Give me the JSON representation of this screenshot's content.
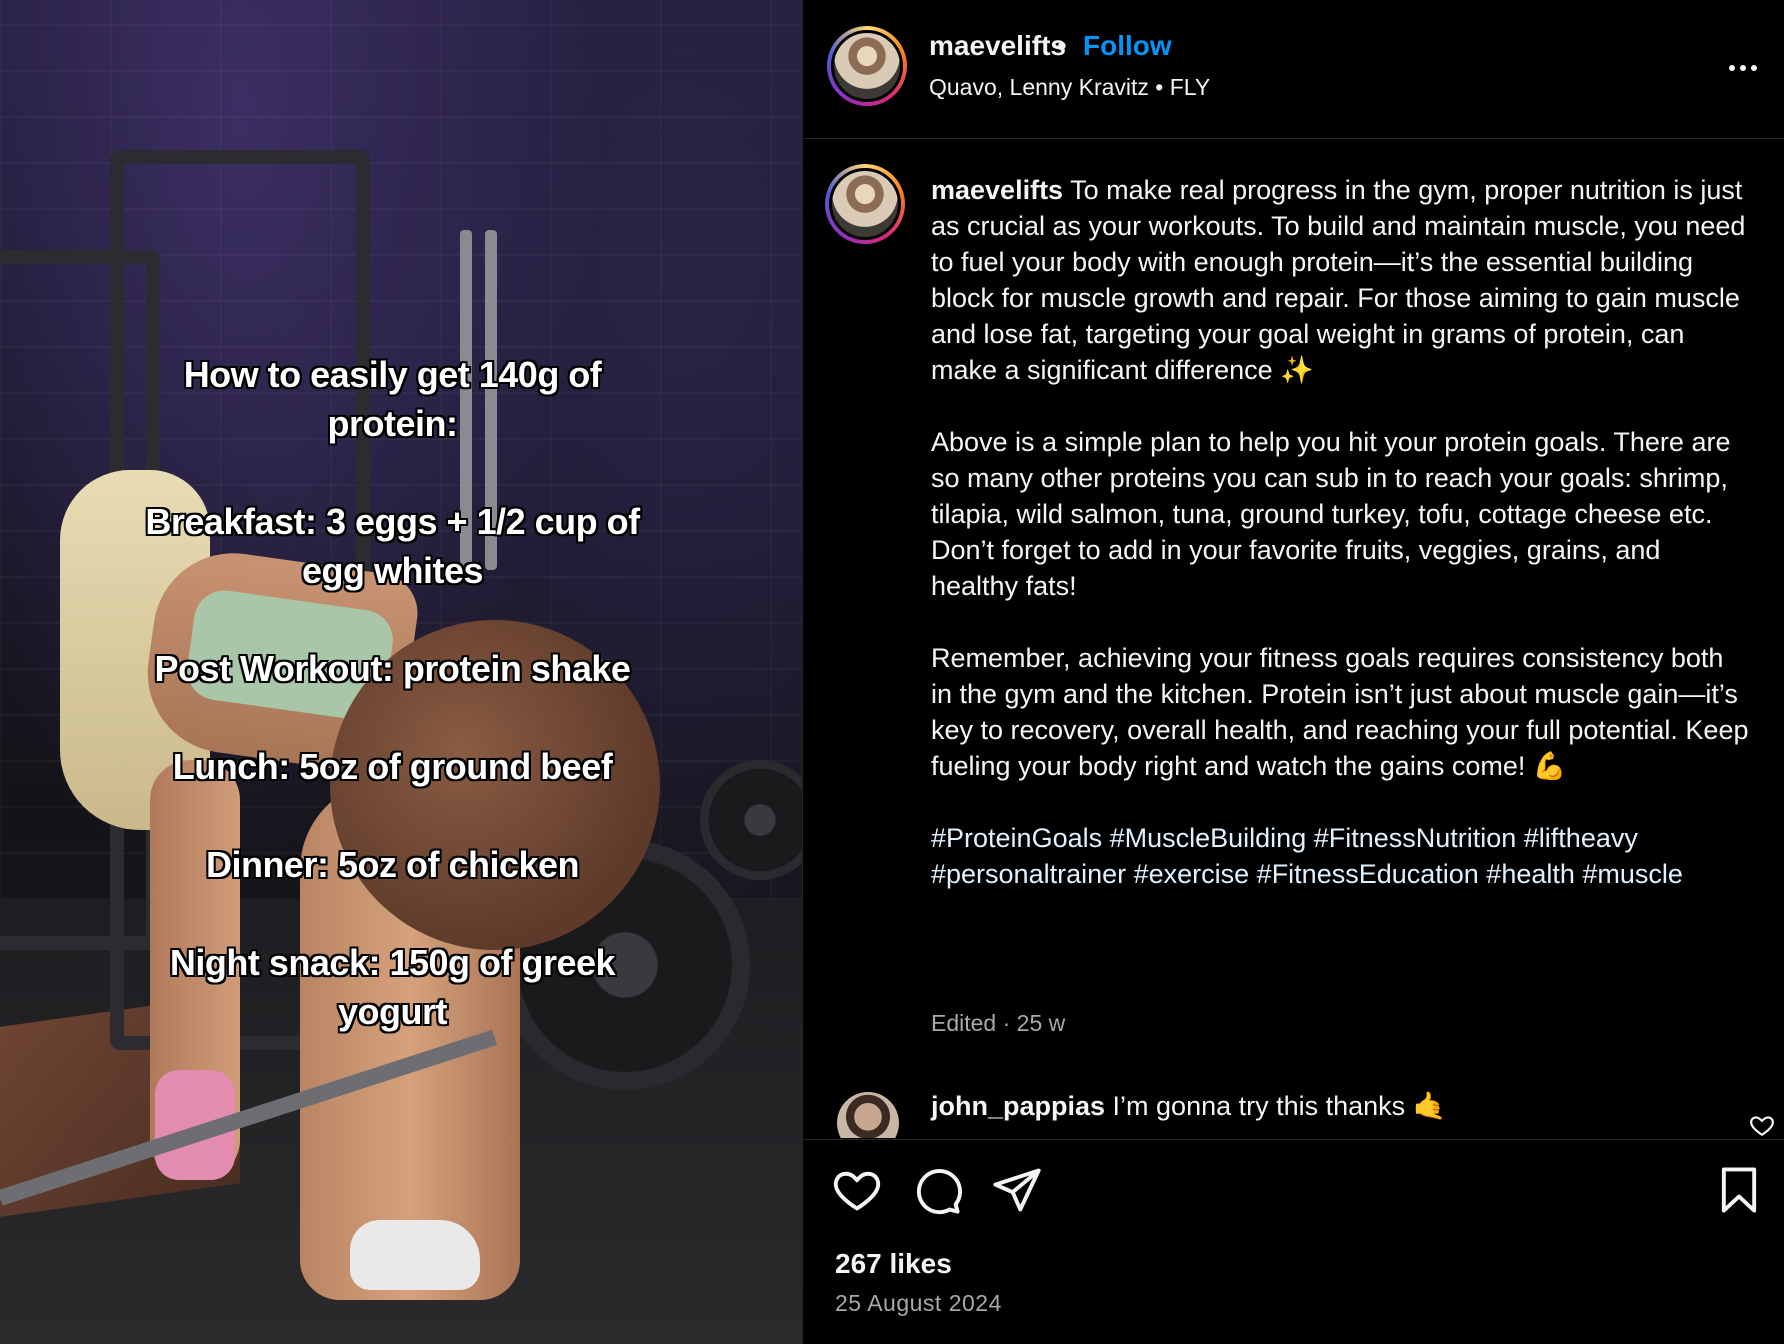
{
  "media": {
    "overlay_lines": [
      "How to easily get 140g of protein:",
      "Breakfast: 3 eggs + 1/2 cup of egg whites",
      "Post Workout: protein shake",
      "Lunch: 5oz of ground beef",
      "Dinner: 5oz of chicken",
      "Night snack: 150g of greek yogurt"
    ]
  },
  "header": {
    "username": "maevelifts",
    "separator": "•",
    "follow_label": "Follow",
    "audio": "Quavo, Lenny Kravitz • FLY",
    "more_icon": "more-horizontal-icon"
  },
  "caption": {
    "username": "maevelifts",
    "paragraph_1": "To make real progress in the gym, proper nutrition is just as crucial as your workouts. To build and maintain muscle, you need to fuel your body with enough protein—it’s the essential building block for muscle growth and repair. For those aiming to gain muscle and lose fat, targeting your goal weight in grams of protein, can make a significant difference ✨",
    "paragraph_2": "Above is a simple plan to help you hit your protein goals. There are so many other proteins you can sub in to reach your goals: shrimp, tilapia, wild salmon, tuna, ground turkey, tofu, cottage cheese etc. Don’t forget to add in your favorite fruits, veggies, grains, and healthy fats!",
    "paragraph_3": "Remember, achieving your fitness goals requires consistency both in the gym and the kitchen. Protein isn’t just about muscle gain—it’s key to recovery, overall health, and reaching your full potential. Keep fueling your body right and watch the gains come! 💪",
    "hashtags": "#ProteinGoals #MuscleBuilding #FitnessNutrition #liftheavy #personaltrainer #exercise #FitnessEducation #health #muscle",
    "meta": "Edited · 25 w"
  },
  "comment": {
    "username": "john_pappias",
    "text": "I’m gonna try this thanks 🤙"
  },
  "actions": {
    "likes": "267 likes",
    "date": "25 August 2024"
  }
}
